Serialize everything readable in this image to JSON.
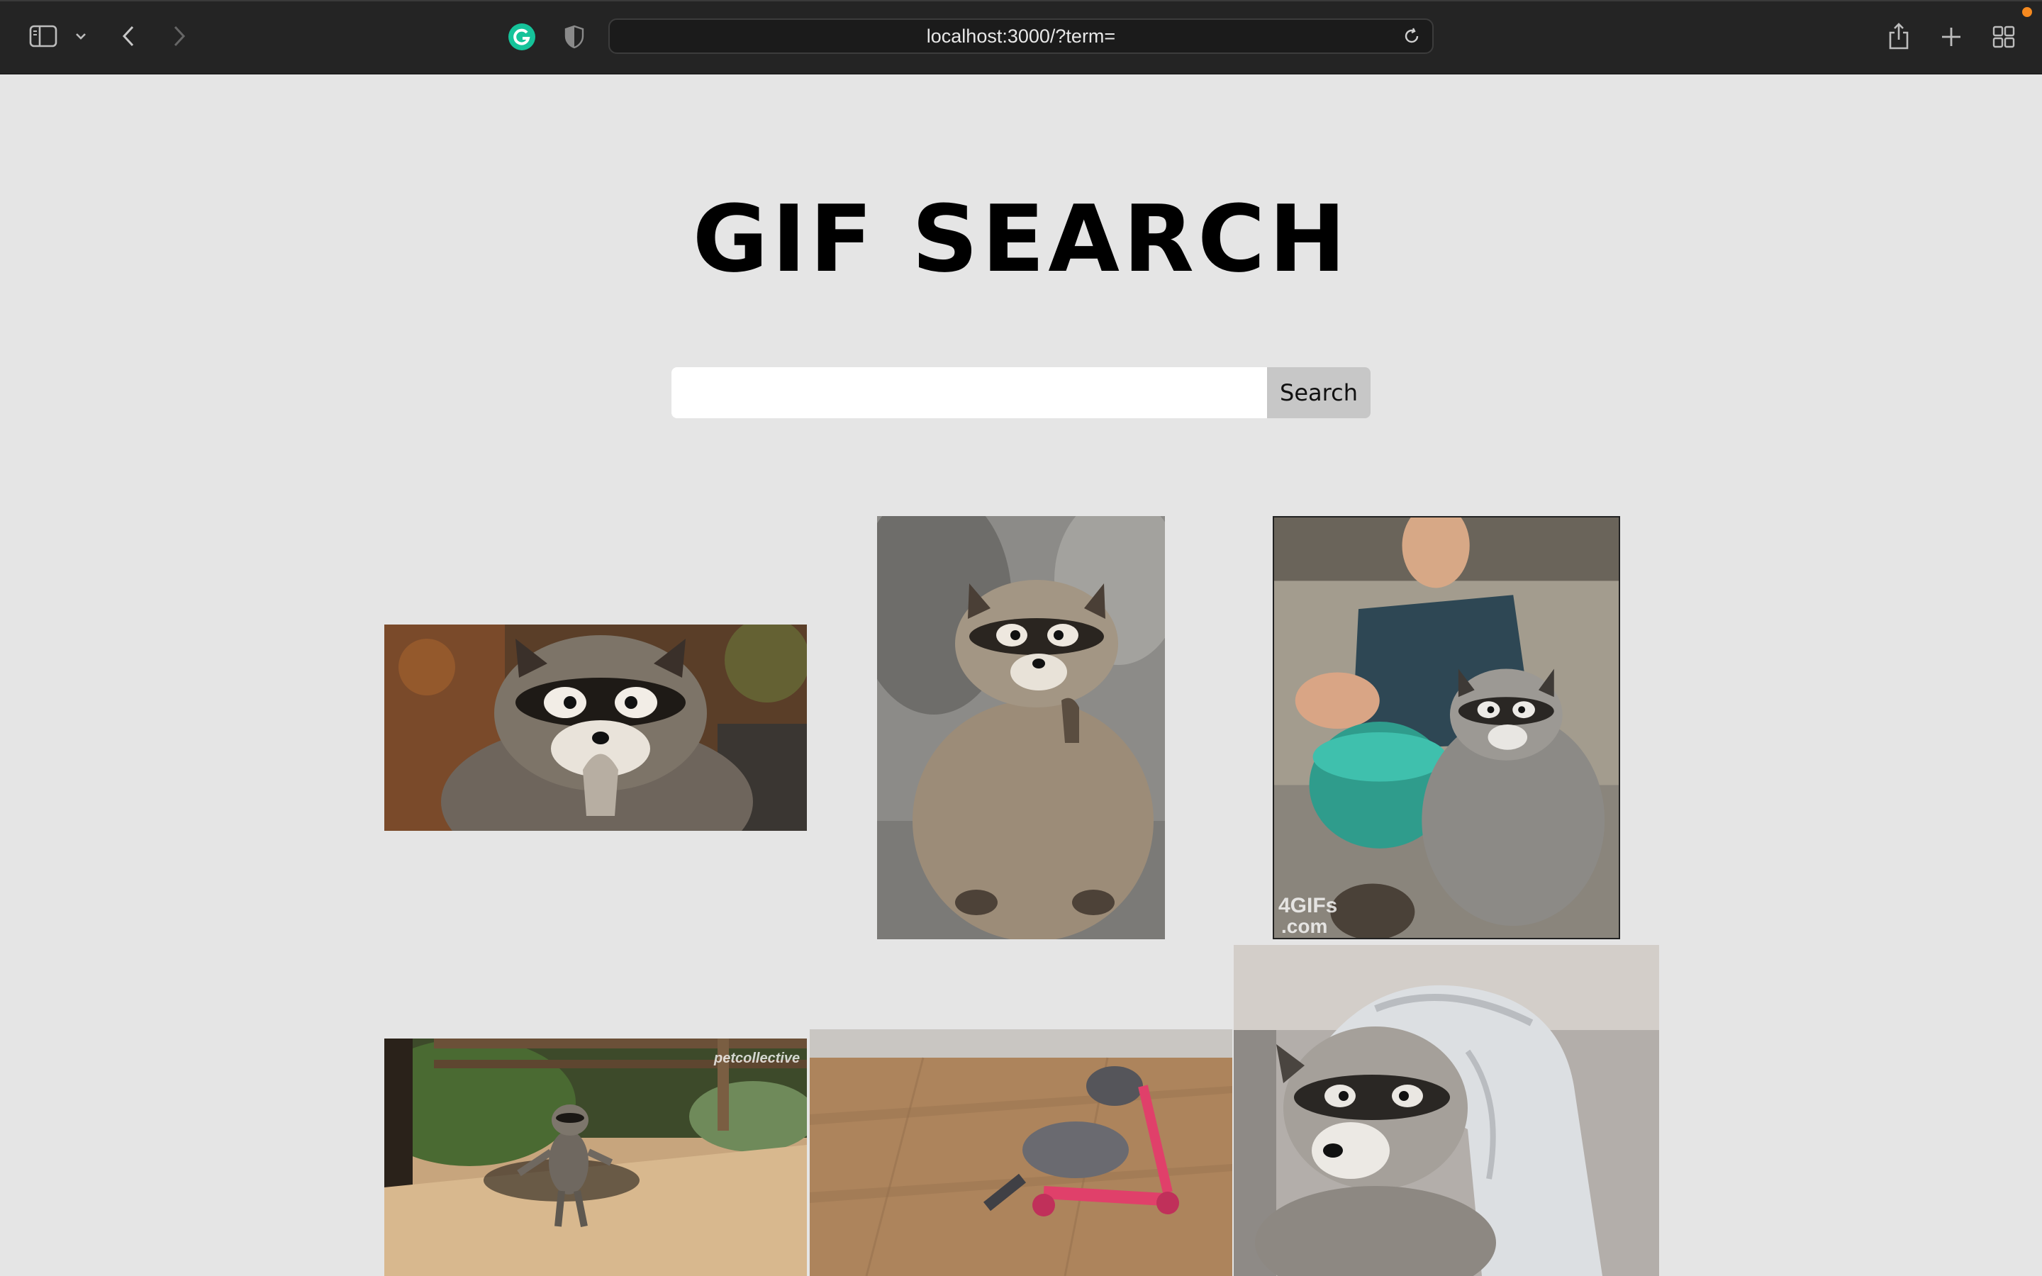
{
  "browser": {
    "url": "localhost:3000/?term=",
    "icons": [
      "sidebar-icon",
      "chevron-down-icon",
      "back-icon",
      "forward-icon",
      "grammarly-icon",
      "shield-icon",
      "reload-icon",
      "share-icon",
      "new-tab-icon",
      "tab-overview-icon"
    ]
  },
  "page": {
    "title": "GIF SEARCH",
    "search": {
      "value": "",
      "placeholder": "",
      "button_label": "Search"
    }
  },
  "colors": {
    "page_background": "#e5e5e5",
    "chrome_background": "#242424",
    "button_background": "#c7c7c7",
    "grammarly_green": "#15c39a",
    "notification_orange": "#f5891f"
  },
  "results": [
    {
      "name": "raccoon-gif-1",
      "caption": ""
    },
    {
      "name": "raccoon-gif-2",
      "caption": ""
    },
    {
      "name": "raccoon-gif-3",
      "caption": "4GIFs .com",
      "caption_line1": "4GIFs",
      "caption_line2": ".com"
    },
    {
      "name": "raccoon-gif-4",
      "caption": "petcollective"
    },
    {
      "name": "raccoon-gif-5",
      "caption": ""
    },
    {
      "name": "raccoon-gif-6",
      "caption": ""
    }
  ]
}
